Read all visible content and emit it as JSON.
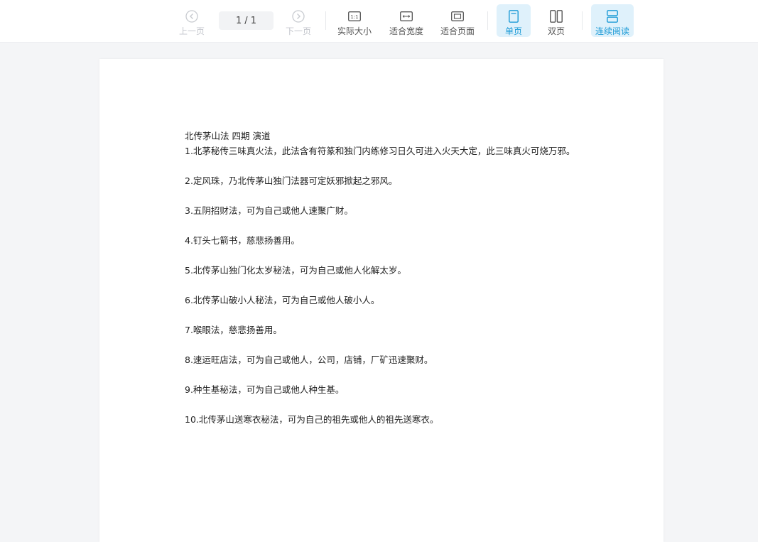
{
  "toolbar": {
    "prev_label": "上一页",
    "page_current": "1",
    "page_sep": "/",
    "page_total": "1",
    "next_label": "下一页",
    "actual_size_label": "实际大小",
    "actual_size_icon_text": "1:1",
    "fit_width_label": "适合宽度",
    "fit_page_label": "适合页面",
    "single_page_label": "单页",
    "double_page_label": "双页",
    "continuous_label": "连续阅读",
    "accent_color": "#1b9ad6",
    "active_bg": "#dff1fb"
  },
  "document": {
    "title": "北传茅山法 四期 演道",
    "items": [
      "1.北茅秘传三味真火法，此法含有符篆和独门内练修习日久可进入火天大定，此三味真火可烧万邪。",
      "2.定风珠，乃北传茅山独门法器可定妖邪掀起之邪风。",
      "3.五阴招财法，可为自己或他人速聚广财。",
      "4.钉头七箭书，慈悲扬善用。",
      "5.北传茅山独门化太岁秘法，可为自己或他人化解太岁。",
      "6.北传茅山破小人秘法，可为自己或他人破小人。",
      "7.喉眼法，慈悲扬善用。",
      "8.速运旺店法，可为自己或他人，公司，店铺，厂矿迅速聚财。",
      "9.种生基秘法，可为自己或他人种生基。",
      "10.北传茅山送寒衣秘法，可为自己的祖先或他人的祖先送寒衣。"
    ]
  }
}
